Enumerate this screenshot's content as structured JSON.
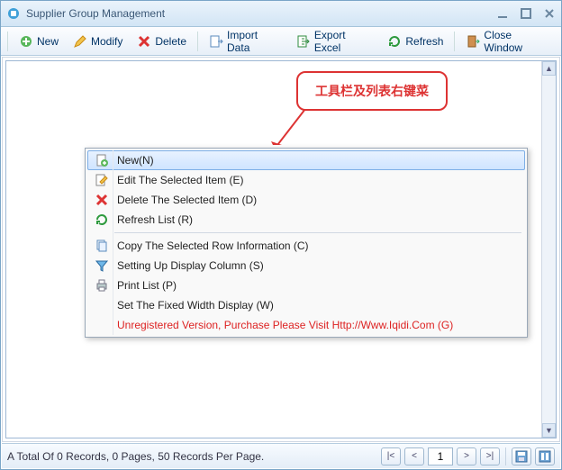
{
  "window": {
    "title": "Supplier Group Management"
  },
  "toolbar": {
    "new": "New",
    "modify": "Modify",
    "delete": "Delete",
    "import": "Import Data",
    "export": "Export Excel",
    "refresh": "Refresh",
    "close": "Close Window"
  },
  "callout": {
    "text": "工具栏及列表右键菜"
  },
  "context_menu": {
    "new": "New(N)",
    "edit": "Edit The Selected Item (E)",
    "delete": "Delete The Selected Item (D)",
    "refresh": "Refresh List  (R)",
    "copy": "Copy The Selected Row Information (C)",
    "columns": "Setting Up Display Column (S)",
    "print": "Print List (P)",
    "fixedwidth": "Set The Fixed Width Display (W)",
    "unregistered": "Unregistered Version, Purchase Please Visit Http://Www.Iqidi.Com  (G)"
  },
  "statusbar": {
    "message": "A Total Of 0 Records, 0 Pages, 50 Records Per Page.",
    "page_input": "1"
  },
  "colors": {
    "accent": "#5b8bbd",
    "danger": "#d33333"
  }
}
